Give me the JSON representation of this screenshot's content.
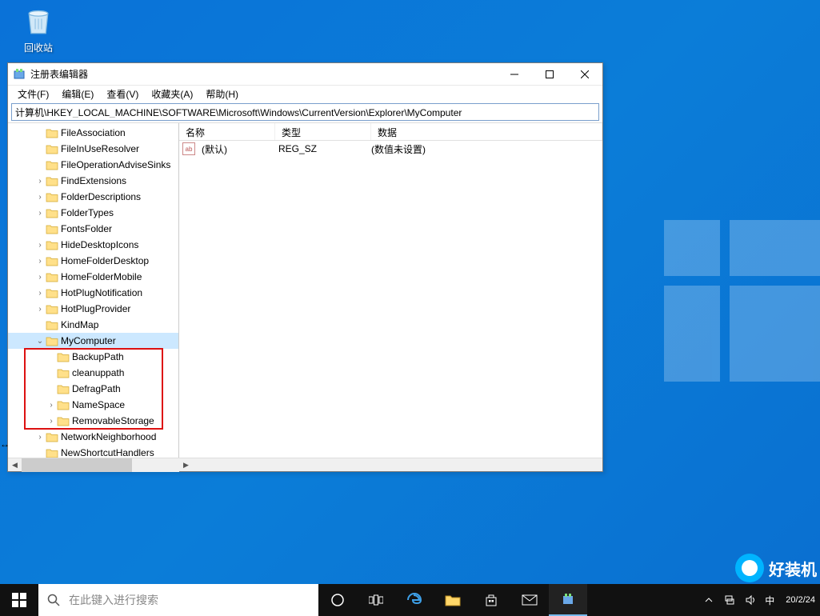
{
  "desktop": {
    "recycle_bin": "回收站"
  },
  "window": {
    "title": "注册表编辑器",
    "menu": {
      "file": "文件(F)",
      "edit": "编辑(E)",
      "view": "查看(V)",
      "favorites": "收藏夹(A)",
      "help": "帮助(H)"
    },
    "address": "计算机\\HKEY_LOCAL_MACHINE\\SOFTWARE\\Microsoft\\Windows\\CurrentVersion\\Explorer\\MyComputer",
    "tree": [
      {
        "name": "FileAssociation",
        "depth": 2,
        "exp": ""
      },
      {
        "name": "FileInUseResolver",
        "depth": 2,
        "exp": ""
      },
      {
        "name": "FileOperationAdviseSinks",
        "depth": 2,
        "exp": ""
      },
      {
        "name": "FindExtensions",
        "depth": 2,
        "exp": ">"
      },
      {
        "name": "FolderDescriptions",
        "depth": 2,
        "exp": ">"
      },
      {
        "name": "FolderTypes",
        "depth": 2,
        "exp": ">"
      },
      {
        "name": "FontsFolder",
        "depth": 2,
        "exp": ""
      },
      {
        "name": "HideDesktopIcons",
        "depth": 2,
        "exp": ">"
      },
      {
        "name": "HomeFolderDesktop",
        "depth": 2,
        "exp": ">"
      },
      {
        "name": "HomeFolderMobile",
        "depth": 2,
        "exp": ">"
      },
      {
        "name": "HotPlugNotification",
        "depth": 2,
        "exp": ">"
      },
      {
        "name": "HotPlugProvider",
        "depth": 2,
        "exp": ">"
      },
      {
        "name": "KindMap",
        "depth": 2,
        "exp": ""
      },
      {
        "name": "MyComputer",
        "depth": 2,
        "exp": "v",
        "selected": true
      },
      {
        "name": "BackupPath",
        "depth": 3,
        "exp": ""
      },
      {
        "name": "cleanuppath",
        "depth": 3,
        "exp": ""
      },
      {
        "name": "DefragPath",
        "depth": 3,
        "exp": ""
      },
      {
        "name": "NameSpace",
        "depth": 3,
        "exp": ">"
      },
      {
        "name": "RemovableStorage",
        "depth": 3,
        "exp": ">"
      },
      {
        "name": "NetworkNeighborhood",
        "depth": 2,
        "exp": ">"
      },
      {
        "name": "NewShortcutHandlers",
        "depth": 2,
        "exp": ""
      }
    ],
    "list": {
      "headers": {
        "name": "名称",
        "type": "类型",
        "data": "数据"
      },
      "rows": [
        {
          "name": "(默认)",
          "type": "REG_SZ",
          "data": "(数值未设置)"
        }
      ]
    }
  },
  "taskbar": {
    "search_placeholder": "在此键入进行搜索",
    "time": "20/2/24",
    "ime": "中"
  },
  "watermark": "好装机"
}
